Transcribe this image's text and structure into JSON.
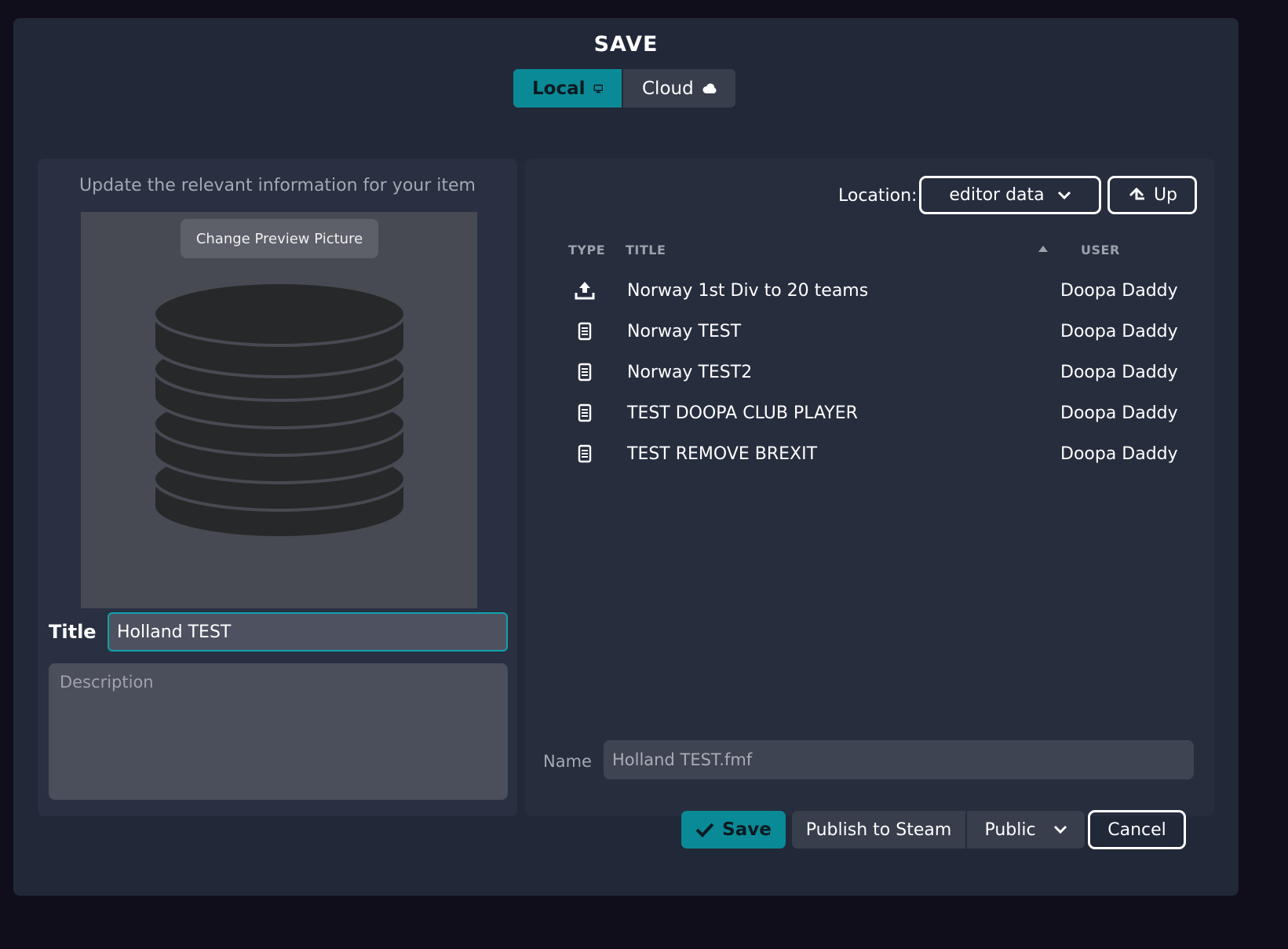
{
  "dialog": {
    "title": "SAVE",
    "tabs": [
      {
        "label": "Local",
        "icon": "monitor-icon",
        "active": true
      },
      {
        "label": "Cloud",
        "icon": "cloud-icon",
        "active": false
      }
    ],
    "accent_color": "#0a8a96"
  },
  "left_panel": {
    "hint": "Update the relevant information for your item",
    "change_picture_label": "Change Preview Picture",
    "preview_icon": "database-icon",
    "title_label": "Title",
    "title_value": "Holland TEST",
    "description_placeholder": "Description",
    "description_value": ""
  },
  "right_panel": {
    "location_label": "Location:",
    "location_value": "editor data",
    "up_label": "Up",
    "columns": {
      "type": "TYPE",
      "title": "TITLE",
      "user": "USER"
    },
    "sort": {
      "column": "title",
      "direction": "ascending"
    },
    "files": [
      {
        "type_icon": "upload-icon",
        "title": "Norway 1st Div to 20 teams",
        "user": "Doopa Daddy"
      },
      {
        "type_icon": "document-icon",
        "title": "Norway TEST",
        "user": "Doopa Daddy"
      },
      {
        "type_icon": "document-icon",
        "title": "Norway TEST2",
        "user": "Doopa Daddy"
      },
      {
        "type_icon": "document-icon",
        "title": "TEST DOOPA CLUB PLAYER",
        "user": "Doopa Daddy"
      },
      {
        "type_icon": "document-icon",
        "title": "TEST REMOVE BREXIT",
        "user": "Doopa Daddy"
      }
    ],
    "name_label": "Name",
    "name_value": "Holland TEST.fmf"
  },
  "footer": {
    "save_label": "Save",
    "publish_label": "Publish to Steam",
    "visibility_value": "Public",
    "cancel_label": "Cancel"
  }
}
